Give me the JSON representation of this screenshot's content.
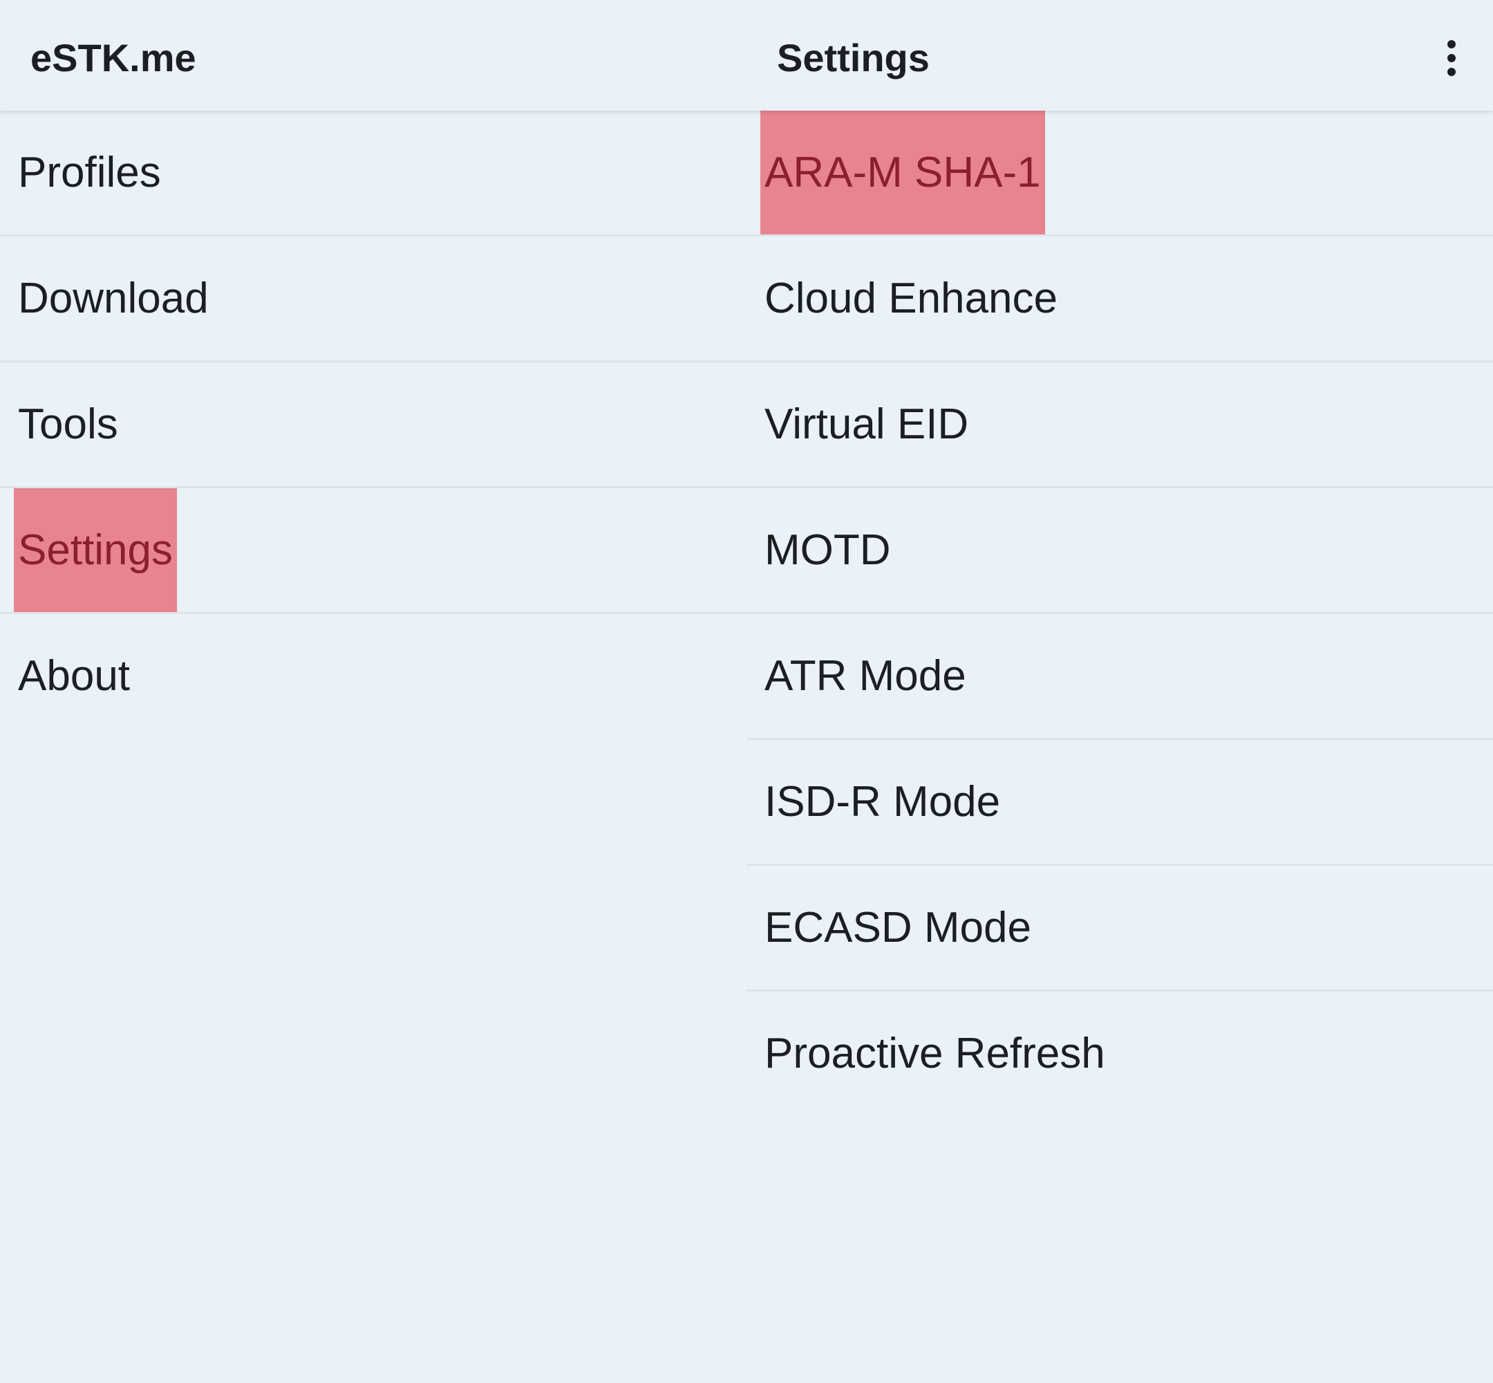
{
  "header": {
    "app_title": "eSTK.me",
    "pane_title": "Settings",
    "overflow_icon": "more-vert-icon"
  },
  "nav": {
    "items": [
      {
        "label": "Profiles"
      },
      {
        "label": "Download"
      },
      {
        "label": "Tools"
      },
      {
        "label": "Settings",
        "highlighted": true
      },
      {
        "label": "About"
      }
    ]
  },
  "settings": {
    "items": [
      {
        "label": "ARA-M SHA-1",
        "highlighted": true
      },
      {
        "label": "Cloud Enhance"
      },
      {
        "label": "Virtual EID"
      },
      {
        "label": "MOTD"
      },
      {
        "label": "ATR Mode"
      },
      {
        "label": "ISD-R Mode"
      },
      {
        "label": "ECASD Mode"
      },
      {
        "label": "Proactive Refresh"
      }
    ]
  },
  "colors": {
    "background": "#eaf1f7",
    "divider": "#dde4ea",
    "highlight": "#e7848f",
    "highlight_text": "#8a1f2e",
    "text": "#1b1f23"
  }
}
